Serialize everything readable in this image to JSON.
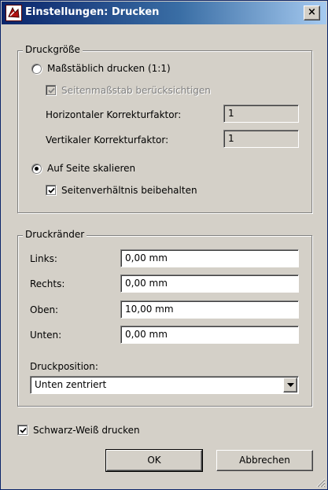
{
  "window": {
    "title": "Einstellungen: Drucken",
    "close_glyph": "×"
  },
  "print_size": {
    "legend": "Druckgröße",
    "scale_radio_label": "Maßstäblich drucken (1:1)",
    "scale_radio_selected": false,
    "page_scale_checkbox_label": "Seitenmaßstab berücksichtigen",
    "page_scale_checked": true,
    "page_scale_disabled": true,
    "h_factor_label": "Horizontaler Korrekturfaktor:",
    "h_factor_value": "1",
    "v_factor_label": "Vertikaler Korrekturfaktor:",
    "v_factor_value": "1",
    "fit_radio_label": "Auf Seite skalieren",
    "fit_radio_selected": true,
    "aspect_checkbox_label": "Seitenverhältnis beibehalten",
    "aspect_checked": true
  },
  "margins": {
    "legend": "Druckränder",
    "left_label": "Links:",
    "left_value": "0,00 mm",
    "right_label": "Rechts:",
    "right_value": "0,00 mm",
    "top_label": "Oben:",
    "top_value": "10,00 mm",
    "bottom_label": "Unten:",
    "bottom_value": "0,00 mm",
    "position_label": "Druckposition:",
    "position_value": "Unten zentriert"
  },
  "bw_checkbox_label": "Schwarz-Weiß drucken",
  "bw_checked": true,
  "buttons": {
    "ok_label": "OK",
    "cancel_label": "Abbrechen"
  },
  "colors": {
    "face": "#d4d0c8",
    "title_active": "#0a246a",
    "disabled_text": "#808080"
  }
}
